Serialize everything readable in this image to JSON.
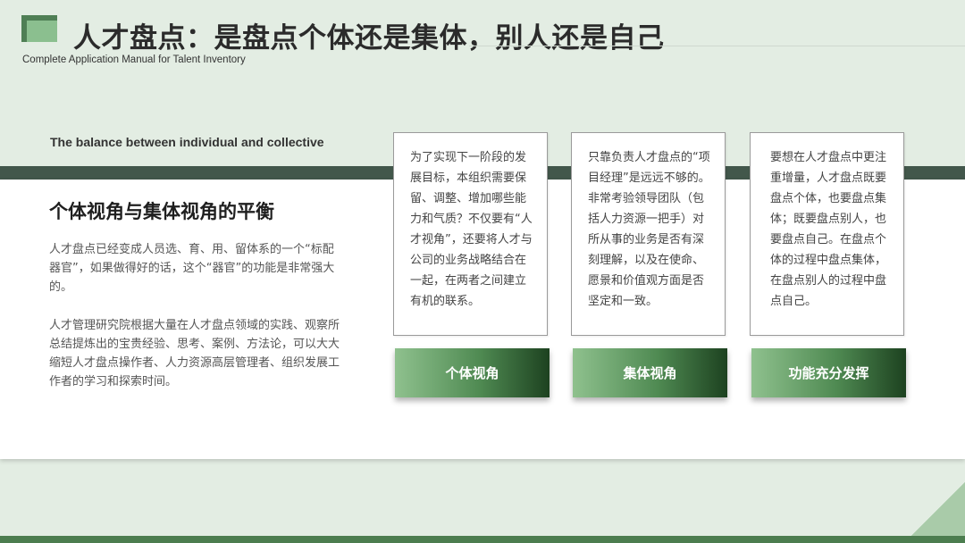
{
  "header": {
    "title": "人才盘点：是盘点个体还是集体，别人还是自己",
    "subtitle": "Complete Application Manual for Talent Inventory"
  },
  "left": {
    "english_label": "The balance between individual  and collective",
    "heading": "个体视角与集体视角的平衡",
    "paragraph1": "人才盘点已经变成人员选、育、用、留体系的一个“标配器官”，如果做得好的话，这个“器官”的功能是非常强大的。",
    "paragraph2": "人才管理研究院根据大量在人才盘点领域的实践、观察所总结提炼出的宝贵经验、思考、案例、方法论，可以大大缩短人才盘点操作者、人力资源高层管理者、组织发展工作者的学习和探索时间。"
  },
  "cards": [
    {
      "text": "为了实现下一阶段的发展目标，本组织需要保留、调整、增加哪些能力和气质？不仅要有“人才视角”，还要将人才与公司的业务战略结合在一起，在两者之间建立有机的联系。",
      "button": "个体视角"
    },
    {
      "text": "只靠负责人才盘点的“项目经理”是远远不够的。非常考验领导团队（包括人力资源一把手）对所从事的业务是否有深刻理解，以及在使命、愿景和价值观方面是否坚定和一致。",
      "button": "集体视角"
    },
    {
      "text": "要想在人才盘点中更注重增量，人才盘点既要盘点个体，也要盘点集体；既要盘点别人，也要盘点自己。在盘点个体的过程中盘点集体，在盘点别人的过程中盘点自己。",
      "button": "功能充分发挥"
    }
  ],
  "colors": {
    "background": "#e3ede3",
    "band": "#42574b",
    "accent_green": "#4f8a52",
    "logo_light": "#8bbf8f",
    "logo_dark": "#4f7f55"
  }
}
